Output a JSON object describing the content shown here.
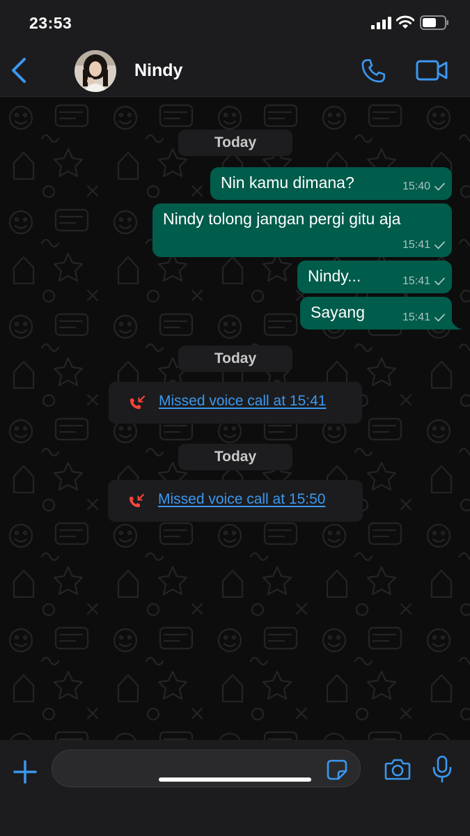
{
  "status_bar": {
    "time": "23:53"
  },
  "header": {
    "contact_name": "Nindy"
  },
  "chat": {
    "date_labels": [
      "Today",
      "Today",
      "Today"
    ],
    "messages": [
      {
        "text": "Nin kamu dimana?",
        "time": "15:40"
      },
      {
        "text": "Nindy tolong jangan pergi gitu aja",
        "time": "15:41"
      },
      {
        "text": "Nindy...",
        "time": "15:41"
      },
      {
        "text": "Sayang",
        "time": "15:41"
      }
    ],
    "missed_calls": [
      {
        "text": "Missed voice call at 15:41"
      },
      {
        "text": "Missed voice call at 15:50"
      }
    ]
  },
  "composer": {
    "placeholder": ""
  },
  "icons": {
    "back": "chevron-left-icon",
    "call": "phone-icon",
    "video": "video-camera-icon",
    "missed_call": "missed-call-icon",
    "plus": "plus-icon",
    "sticker": "sticker-icon",
    "camera": "camera-icon",
    "mic": "microphone-icon"
  },
  "colors": {
    "accent": "#3b98f0",
    "outgoing_bubble": "#005c4b",
    "missed_call": "#ff453a"
  }
}
